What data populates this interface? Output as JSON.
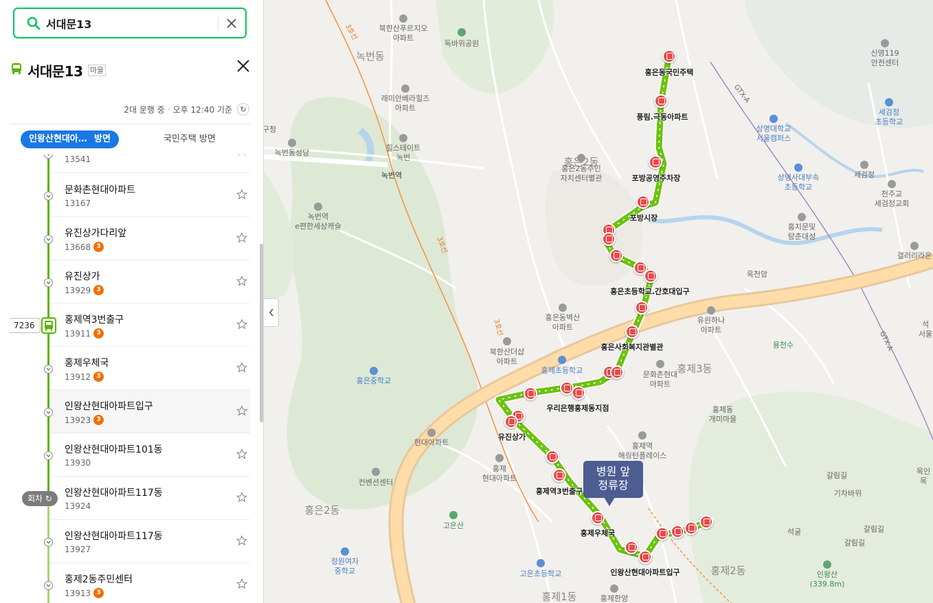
{
  "search": {
    "value": "서대문13",
    "placeholder": ""
  },
  "route": {
    "name": "서대문13",
    "type_badge": "마을"
  },
  "status": {
    "operating": "2대 운행 중",
    "time": "오후 12:40 기준"
  },
  "tabs": [
    {
      "label": "인왕산현대아...",
      "suffix": "방면",
      "active": true
    },
    {
      "label": "국민주택 방면",
      "active": false
    }
  ],
  "bus": {
    "plate": "7236"
  },
  "turn_badge": "회차 ↻",
  "stops": [
    {
      "name": "",
      "id": "13541",
      "badge": ""
    },
    {
      "name": "문화촌현대아파트",
      "id": "13167",
      "badge": ""
    },
    {
      "name": "유진상가다리앞",
      "id": "13668",
      "badge": "3"
    },
    {
      "name": "유진상가",
      "id": "13929",
      "badge": "3"
    },
    {
      "name": "홍제역3번출구",
      "id": "13911",
      "badge": "3"
    },
    {
      "name": "홍제우체국",
      "id": "13912",
      "badge": "3"
    },
    {
      "name": "인왕산현대아파트입구",
      "id": "13923",
      "badge": "3"
    },
    {
      "name": "인왕산현대아파트101동",
      "id": "13930",
      "badge": ""
    },
    {
      "name": "인왕산현대아파트117동",
      "id": "13924",
      "badge": ""
    },
    {
      "name": "인왕산현대아파트117동",
      "id": "13927",
      "badge": ""
    },
    {
      "name": "홍제2동주민센터",
      "id": "13913",
      "badge": "3"
    }
  ],
  "callout": {
    "line1": "병원 앞",
    "line2": "정류장"
  },
  "map": {
    "districts": [
      "녹번동",
      "홍은2동",
      "홍제3동",
      "홍제2동",
      "홍은2동",
      "홍제1동"
    ],
    "route_stop_labels": [
      "홍은동국민주택",
      "풍림.극동아파트",
      "포방공영주차장",
      "포방시장",
      "홍은초등학교.간호대입구",
      "홍은사회복지관별관",
      "우리은행홍제동지점",
      "유진상가",
      "홍제역3번출구",
      "홍제우체국",
      "인왕산현대아파트입구"
    ],
    "pois": {
      "bukhansan_fuerzio": "북한산푸르지오\n아파트",
      "dokbawi_park": "독바위공원",
      "ramian_bellahills": "래미안베라힐즈\n아파트",
      "hillstate_nokbeon": "힐스테이트\n녹번",
      "nokbeon_cathedral": "녹번동성당",
      "nokbeon_station": "녹번역",
      "nokbeon_epyeonhan": "녹번역\ne편한세상캐슬",
      "gu_office": "구청",
      "hongeun2_center": "홍은2동주민\n자치센터별관",
      "hongeun_byeoksan": "홍은동벽산\n아파트",
      "bukhansan_theshop": "북한산더샵\n아파트",
      "hongje_elem": "홍제초등학교",
      "munhwachon_hyundai": "문화촌현대\n아파트",
      "hongeun_middle": "홍은중학교",
      "hyundai_apt": "현대아파트",
      "hongje_hyundai": "홍제\n현대아파트",
      "convention": "컨벤션센터",
      "goeun_mt": "고은산",
      "jeongwon_girls": "정원여자\n중학교",
      "goeun_elem": "고은초등학교",
      "hongje_hanyang": "홍제한양",
      "hongje_station_hill": "홍제역\n해링턴플레이스",
      "hongje_gaemi": "홍제동\n개미마을",
      "yujin_hana": "유원하나\n아파트",
      "okcheonam": "옥천암",
      "sinyoung_119": "신영119\n안전센터",
      "sangmyung_univ": "상명대학교\n서울캠퍼스",
      "sangmyung_elem": "상명사대부속\n초등학교",
      "segeomjeong": "세검정",
      "segeomjeong_elem": "세검정\n초등학교",
      "cheonjugyo": "천주교\n세검정교회",
      "hongji_gate": "홍지문및\n탕춘대성",
      "gallery": "갤러리라온",
      "yongcheonsu": "용천수",
      "galrim_road": "갈림길",
      "gichabawi": "기차바위",
      "seokgul": "석굴",
      "inwangsan": "인왕산\n(339.8m)",
      "gtx": "GTX-A",
      "line3": "3호선",
      "seodaemun_right": "석\n서울",
      "mokin": "목인\n목"
    }
  },
  "colors": {
    "brand_green": "#03c75a",
    "route_green": "#5ab500",
    "tab_blue": "#1978e5",
    "stop_red": "#e84c4c",
    "badge_orange": "#f06f00",
    "callout": "#4d5d92"
  },
  "icons": [
    "search-icon",
    "clear-icon",
    "bus-icon",
    "close-icon",
    "refresh-icon",
    "chevron-left-icon",
    "star-icon",
    "chevron-down-icon"
  ]
}
